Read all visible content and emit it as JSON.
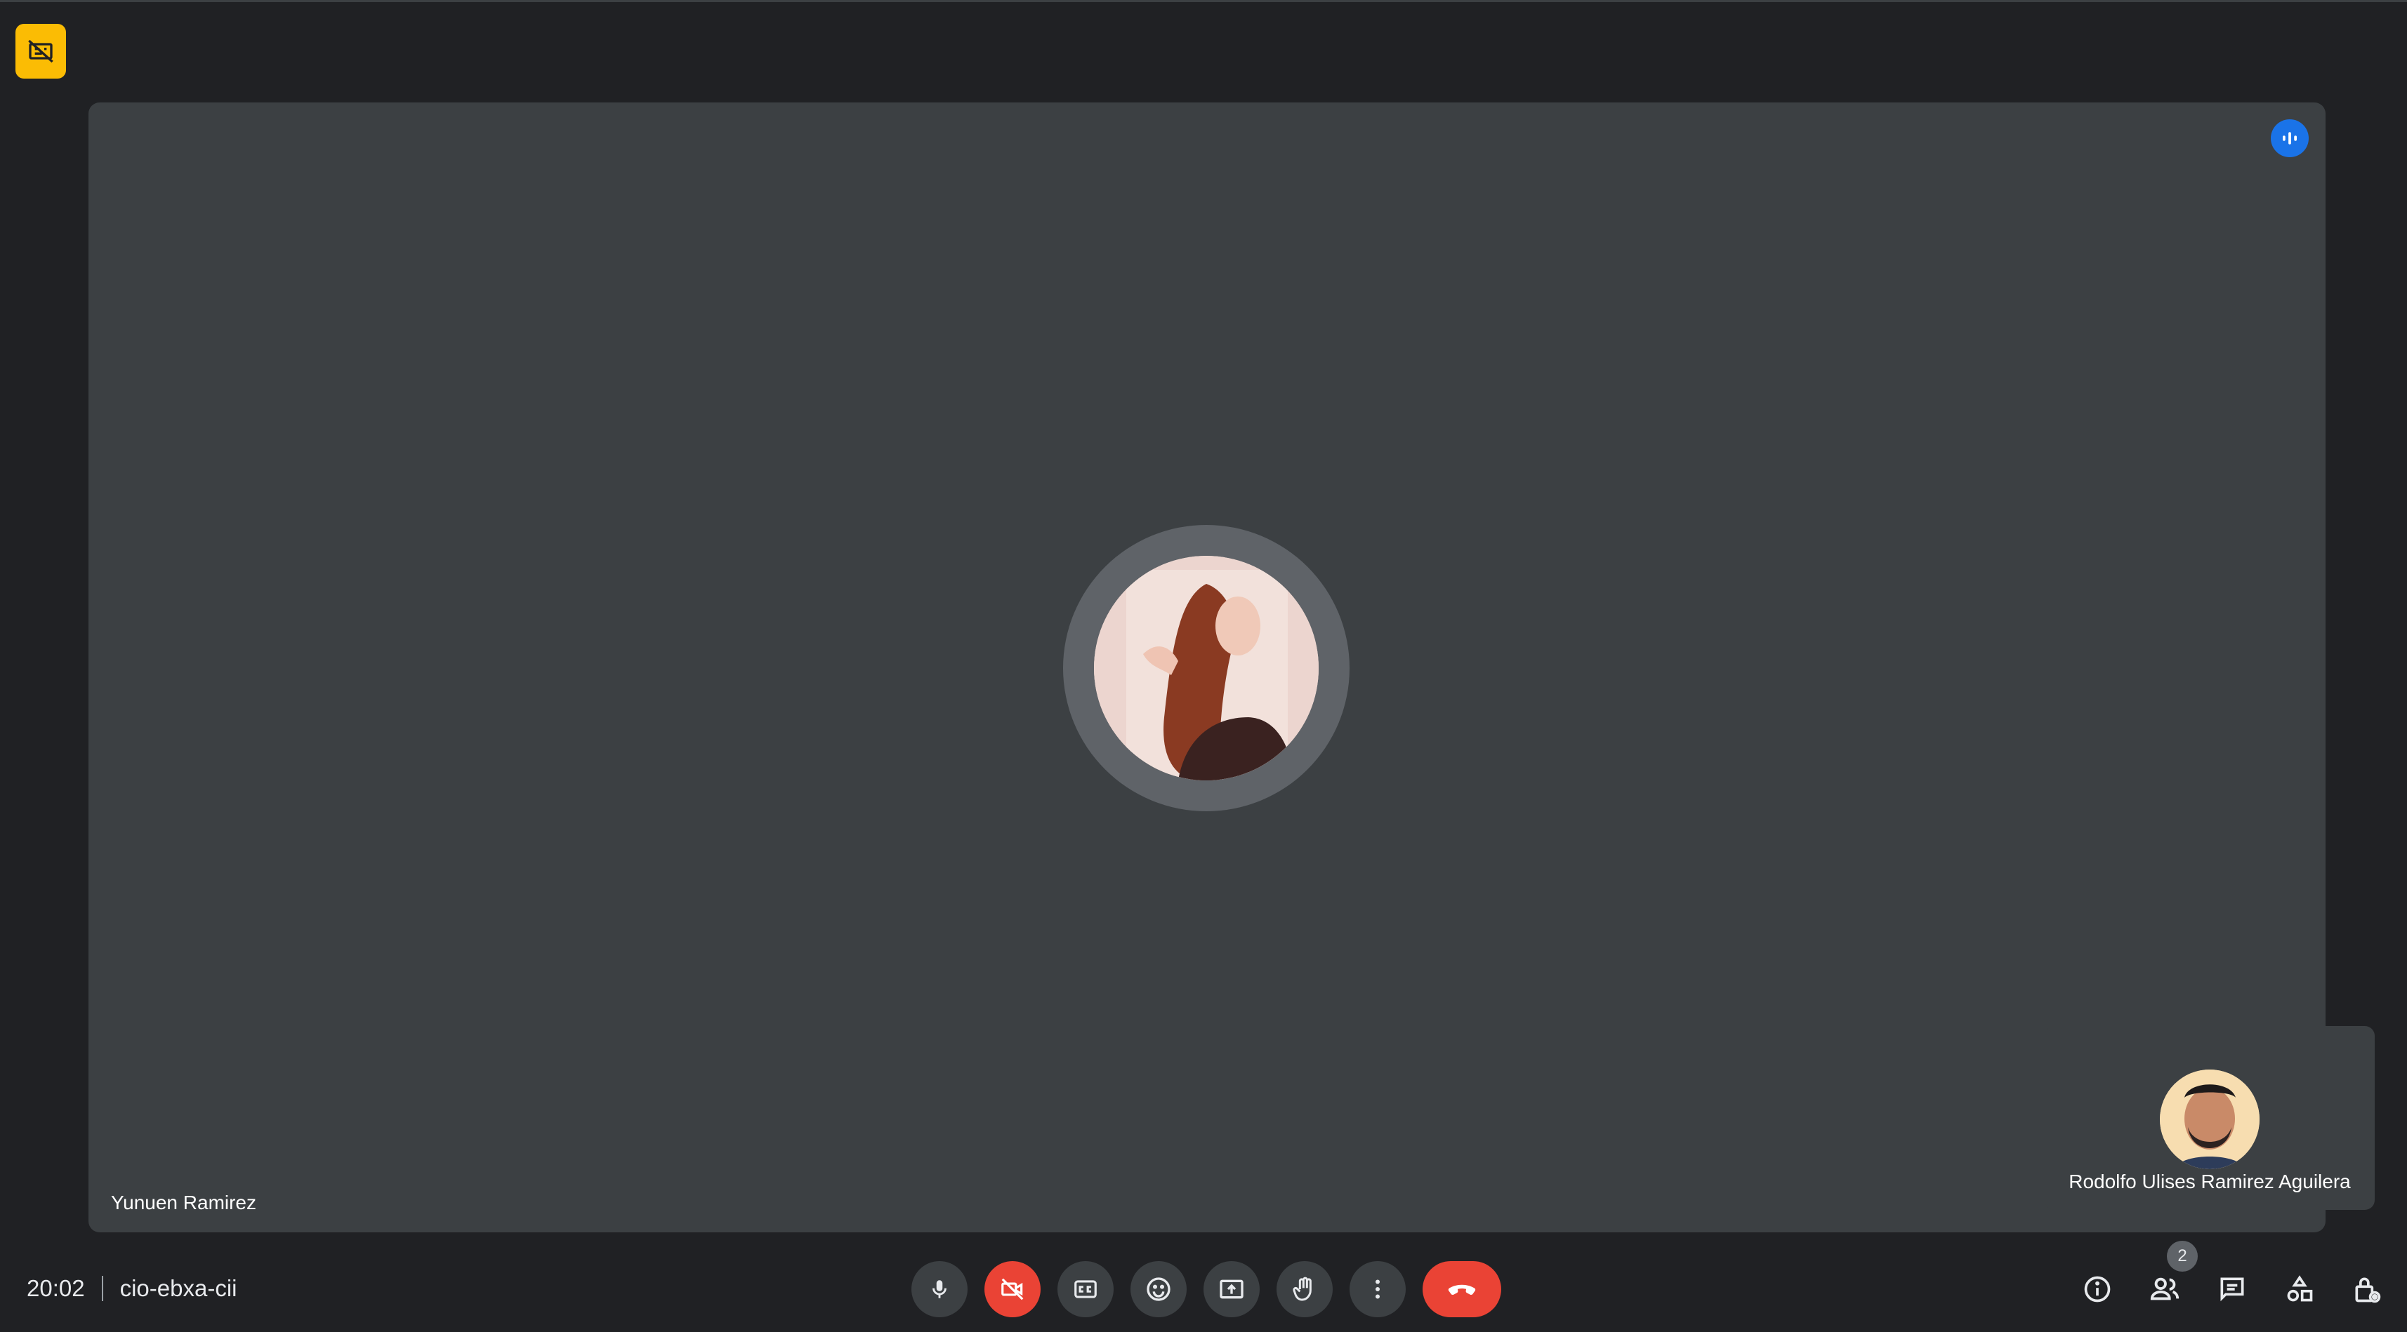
{
  "recording_indicator_icon": "recording-off-icon",
  "main_tile": {
    "participant_name": "Yunuen Ramirez",
    "speaking_icon": "speaking-indicator-icon"
  },
  "self_tile": {
    "participant_name": "Rodolfo Ulises Ramirez Aguilera"
  },
  "meeting": {
    "time": "20:02",
    "code": "cio-ebxa-cii"
  },
  "controls": [
    {
      "name": "microphone",
      "icon": "mic-icon"
    },
    {
      "name": "camera",
      "icon": "camera-off-icon",
      "state": "off",
      "color": "#ea4335"
    },
    {
      "name": "captions",
      "icon": "closed-captions-icon"
    },
    {
      "name": "reactions",
      "icon": "emoji-icon"
    },
    {
      "name": "present",
      "icon": "present-screen-icon"
    },
    {
      "name": "raise-hand",
      "icon": "hand-icon"
    },
    {
      "name": "more-options",
      "icon": "more-vert-icon"
    },
    {
      "name": "leave-call",
      "icon": "call-end-icon",
      "color": "#ea4335"
    }
  ],
  "right_panel": {
    "people_count": "2",
    "icons": [
      "info-icon",
      "people-icon",
      "chat-icon",
      "activities-icon",
      "host-controls-icon"
    ]
  },
  "colors": {
    "background": "#202124",
    "tile": "#3c4043",
    "danger": "#ea4335",
    "accent": "#1a73e8",
    "recording": "#fbbc04"
  }
}
